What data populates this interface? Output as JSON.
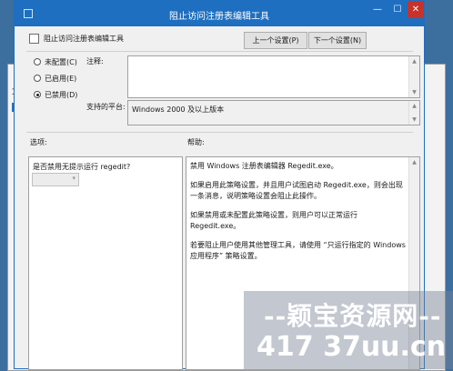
{
  "background_window": {
    "menu_fragment": "文"
  },
  "titlebar": {
    "title": "阻止访问注册表编辑工具",
    "min_label": "—",
    "max_label": "☐",
    "close_label": "✕"
  },
  "policy": {
    "name": "阻止访问注册表编辑工具"
  },
  "nav": {
    "prev_label": "上一个设置(P)",
    "next_label": "下一个设置(N)"
  },
  "state": {
    "options": [
      {
        "label": "未配置(C)",
        "selected": false
      },
      {
        "label": "已启用(E)",
        "selected": false
      },
      {
        "label": "已禁用(D)",
        "selected": true
      }
    ]
  },
  "comment": {
    "label": "注释:",
    "value": ""
  },
  "platform": {
    "label": "支持的平台:",
    "value": "Windows 2000 及以上版本"
  },
  "options_panel": {
    "label": "选项:",
    "question": "是否禁用无提示运行 regedit?",
    "combo_value": ""
  },
  "help_panel": {
    "label": "帮助:",
    "paragraphs": [
      "禁用 Windows 注册表编辑器 Regedit.exe。",
      "如果启用此策略设置，并且用户试图启动 Regedit.exe，则会出现一条消息，说明策略设置会阻止此操作。",
      "如果禁用或未配置此策略设置，则用户可以正常运行 Regedit.exe。",
      "若要阻止用户使用其他管理工具，请使用 “只运行指定的 Windows 应用程序” 策略设置。"
    ]
  },
  "watermark": {
    "line1": "--颖宝资源网--",
    "line2": "417 37uu.cn"
  }
}
